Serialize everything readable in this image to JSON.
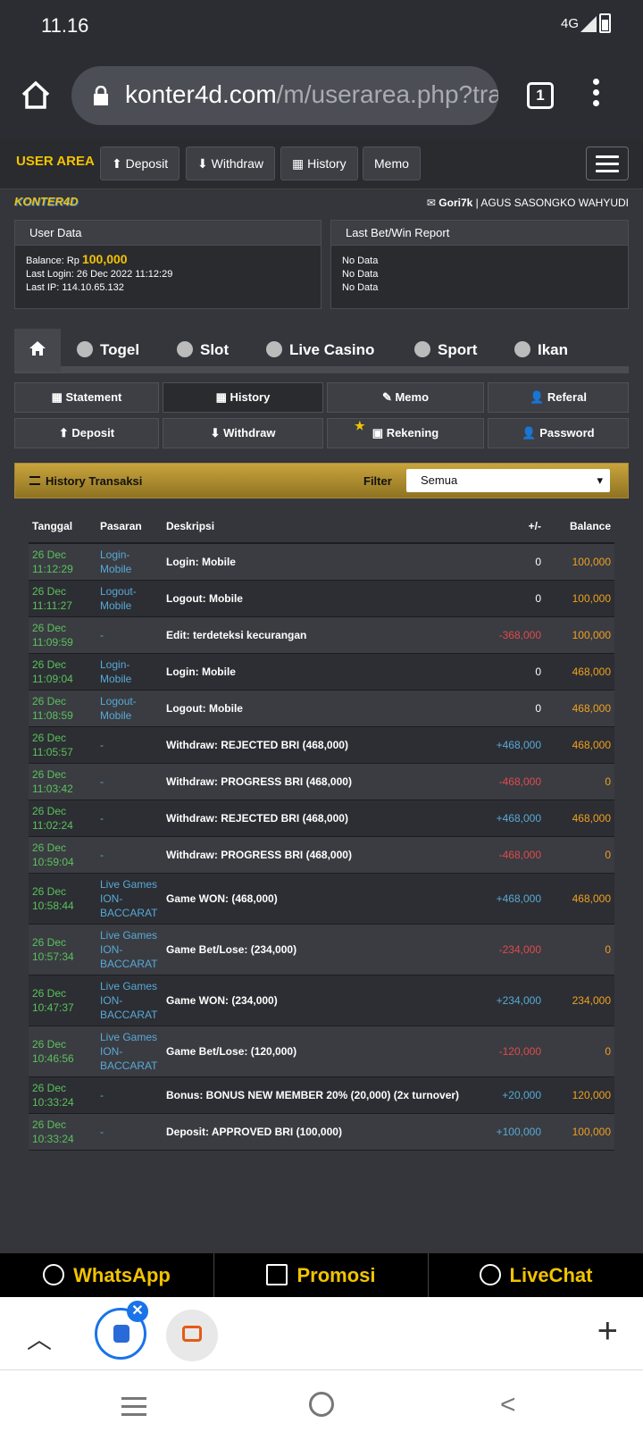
{
  "status": {
    "time": "11.16",
    "network": "4G"
  },
  "browser": {
    "url_host": "konter4d.com",
    "url_path": "/m/userarea.php?tra",
    "tab_count": "1"
  },
  "topnav": {
    "brand": "USER AREA",
    "buttons": [
      "Deposit",
      "Withdraw",
      "History",
      "Memo"
    ]
  },
  "user": {
    "logo": "KONTER4D",
    "username": "Gori7k",
    "fullname": " | AGUS SASONGKO WAHYUDI"
  },
  "userdata": {
    "title": "User Data",
    "balance_label": "Balance: Rp ",
    "balance": "100,000",
    "last_login": "Last Login: 26 Dec 2022 11:12:29",
    "last_ip": "Last IP: 114.10.65.132"
  },
  "lastbet": {
    "title": "Last Bet/Win Report",
    "lines": [
      "No Data",
      "No Data",
      "No Data"
    ]
  },
  "gametabs": [
    "Togel",
    "Slot",
    "Live Casino",
    "Sport",
    "Ikan"
  ],
  "subnav": [
    "Statement",
    "History",
    "Memo",
    "Referal",
    "Deposit",
    "Withdraw",
    "Rekening",
    "Password"
  ],
  "history": {
    "title": "History Transaksi",
    "filter_label": "Filter",
    "filter_value": "Semua",
    "columns": [
      "Tanggal",
      "Pasaran",
      "Deskripsi",
      "+/-",
      "Balance"
    ],
    "rows": [
      {
        "date": "26 Dec",
        "time": "11:12:29",
        "pasaran": "Login-Mobile",
        "desc": "Login: Mobile",
        "amount": "0",
        "balance": "100,000",
        "sign": "zero"
      },
      {
        "date": "26 Dec",
        "time": "11:11:27",
        "pasaran": "Logout-Mobile",
        "desc": "Logout: Mobile",
        "amount": "0",
        "balance": "100,000",
        "sign": "zero"
      },
      {
        "date": "26 Dec",
        "time": "11:09:59",
        "pasaran": "-",
        "desc": "Edit: terdeteksi kecurangan",
        "amount": "-368,000",
        "balance": "100,000",
        "sign": "neg"
      },
      {
        "date": "26 Dec",
        "time": "11:09:04",
        "pasaran": "Login-Mobile",
        "desc": "Login: Mobile",
        "amount": "0",
        "balance": "468,000",
        "sign": "zero"
      },
      {
        "date": "26 Dec",
        "time": "11:08:59",
        "pasaran": "Logout-Mobile",
        "desc": "Logout: Mobile",
        "amount": "0",
        "balance": "468,000",
        "sign": "zero"
      },
      {
        "date": "26 Dec",
        "time": "11:05:57",
        "pasaran": "-",
        "desc": "Withdraw: REJECTED BRI (468,000)",
        "amount": "+468,000",
        "balance": "468,000",
        "sign": "pos"
      },
      {
        "date": "26 Dec",
        "time": "11:03:42",
        "pasaran": "-",
        "desc": "Withdraw: PROGRESS BRI (468,000)",
        "amount": "-468,000",
        "balance": "0",
        "sign": "neg"
      },
      {
        "date": "26 Dec",
        "time": "11:02:24",
        "pasaran": "-",
        "desc": "Withdraw: REJECTED BRI (468,000)",
        "amount": "+468,000",
        "balance": "468,000",
        "sign": "pos"
      },
      {
        "date": "26 Dec",
        "time": "10:59:04",
        "pasaran": "-",
        "desc": "Withdraw: PROGRESS BRI (468,000)",
        "amount": "-468,000",
        "balance": "0",
        "sign": "neg"
      },
      {
        "date": "26 Dec",
        "time": "10:58:44",
        "pasaran": "Live Games ION-BACCARAT",
        "desc": "Game WON: (468,000)",
        "amount": "+468,000",
        "balance": "468,000",
        "sign": "pos"
      },
      {
        "date": "26 Dec",
        "time": "10:57:34",
        "pasaran": "Live Games ION-BACCARAT",
        "desc": "Game Bet/Lose: (234,000)",
        "amount": "-234,000",
        "balance": "0",
        "sign": "neg"
      },
      {
        "date": "26 Dec",
        "time": "10:47:37",
        "pasaran": "Live Games ION-BACCARAT",
        "desc": "Game WON: (234,000)",
        "amount": "+234,000",
        "balance": "234,000",
        "sign": "pos"
      },
      {
        "date": "26 Dec",
        "time": "10:46:56",
        "pasaran": "Live Games ION-BACCARAT",
        "desc": "Game Bet/Lose: (120,000)",
        "amount": "-120,000",
        "balance": "0",
        "sign": "neg"
      },
      {
        "date": "26 Dec",
        "time": "10:33:24",
        "pasaran": "-",
        "desc": "Bonus: BONUS NEW MEMBER 20% (20,000) (2x turnover)",
        "amount": "+20,000",
        "balance": "120,000",
        "sign": "pos"
      },
      {
        "date": "26 Dec",
        "time": "10:33:24",
        "pasaran": "-",
        "desc": "Deposit: APPROVED BRI (100,000)",
        "amount": "+100,000",
        "balance": "100,000",
        "sign": "pos"
      }
    ]
  },
  "bottombar": [
    "WhatsApp",
    "Promosi",
    "LiveChat"
  ],
  "colors": {
    "gold": "#f2c300",
    "green_date": "#5cc15c",
    "blue_link": "#58a9d6",
    "red_negative": "#e04a4a",
    "orange_balance": "#f0a020"
  }
}
